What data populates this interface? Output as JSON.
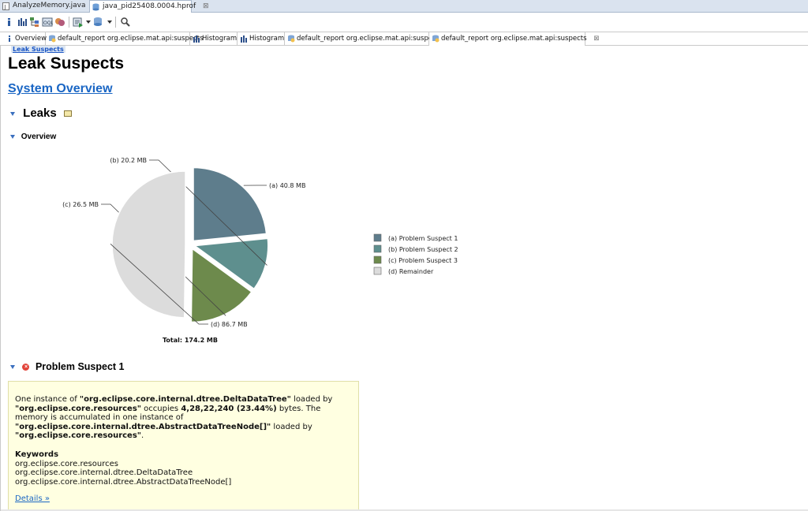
{
  "editor_tabs": [
    {
      "label": "AnalyzeMemory.java",
      "close": ""
    },
    {
      "label": "java_pid25408.0004.hprof",
      "close": "⊠"
    }
  ],
  "report_tabs": [
    {
      "label": "Overview"
    },
    {
      "label": "default_report  org.eclipse.mat.api:suspects"
    },
    {
      "label": "Histogram"
    },
    {
      "label": "Histogram"
    },
    {
      "label": "default_report  org.eclipse.mat.api:suspects"
    },
    {
      "label": "default_report  org.eclipse.mat.api:suspects",
      "close": "⊠"
    }
  ],
  "breadcrumb": "Leak Suspects",
  "page_title": "Leak Suspects",
  "system_overview_link": "System Overview",
  "leaks_heading": "Leaks",
  "overview_heading": "Overview",
  "problem_heading": "Problem Suspect 1",
  "chart_data": {
    "type": "pie",
    "unit": "MB",
    "slices": [
      {
        "key": "(a)",
        "value": 40.8,
        "label": "40.8 MB",
        "legend": "Problem Suspect 1",
        "color": "#5e7d8c"
      },
      {
        "key": "(b)",
        "value": 20.2,
        "label": "20.2 MB",
        "legend": "Problem Suspect 2",
        "color": "#5e8f8e"
      },
      {
        "key": "(c)",
        "value": 26.5,
        "label": "26.5 MB",
        "legend": "Problem Suspect 3",
        "color": "#6d8a4c"
      },
      {
        "key": "(d)",
        "value": 86.7,
        "label": "86.7 MB",
        "legend": "Remainder",
        "color": "#dcdcdc"
      }
    ],
    "total_label": "Total: 174.2 MB",
    "legend_position": "right"
  },
  "suspect": {
    "p1": "One instance of ",
    "p2": "\"org.eclipse.core.internal.dtree.DeltaDataTree\"",
    "p3": " loaded by ",
    "p4": "\"org.eclipse.core.resources\"",
    "p5": " occupies ",
    "p6": "4,28,22,240 (23.44%)",
    "p7": " bytes. The memory is accumulated in one instance of ",
    "p8": "\"org.eclipse.core.internal.dtree.AbstractDataTreeNode[]\"",
    "p9": " loaded by ",
    "p10": "\"org.eclipse.core.resources\"",
    "p11": ".",
    "keywords_title": "Keywords",
    "keywords": [
      "org.eclipse.core.resources",
      "org.eclipse.core.internal.dtree.DeltaDataTree",
      "org.eclipse.core.internal.dtree.AbstractDataTreeNode[]"
    ],
    "details_link": "Details »"
  }
}
